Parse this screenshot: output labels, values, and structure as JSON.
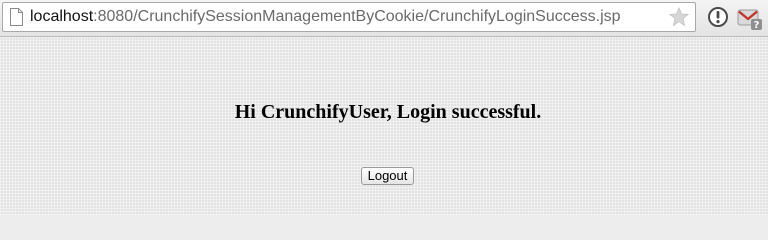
{
  "browser": {
    "url_host": "localhost",
    "url_rest": ":8080/CrunchifySessionManagementByCookie/CrunchifyLoginSuccess.jsp",
    "icons": {
      "page": "page-icon",
      "bookmark": "star-icon",
      "extension": "info-icon",
      "mail": "gmail-icon",
      "mail_badge": "?"
    }
  },
  "page": {
    "message": "Hi CrunchifyUser, Login successful.",
    "logout_label": "Logout"
  },
  "colors": {
    "background": "#ededed",
    "url_host": "#111111",
    "url_rest": "#6a6a6a",
    "gmail_red": "#c5332a"
  }
}
